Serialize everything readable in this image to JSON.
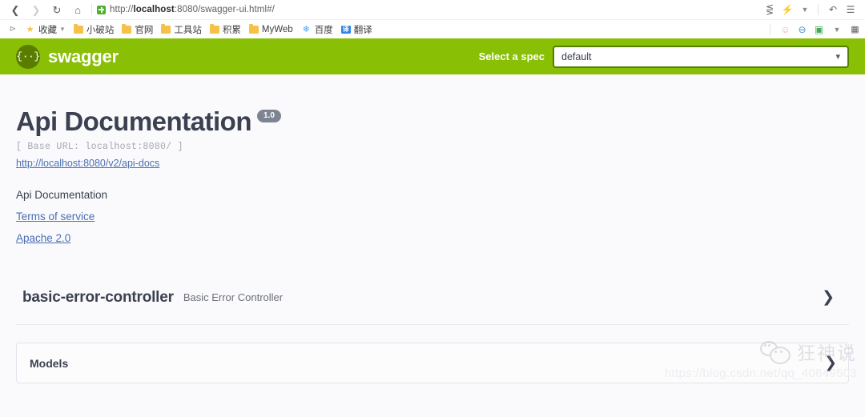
{
  "browser": {
    "nav": {
      "back_icon": "chevron-left-icon",
      "forward_icon": "chevron-right-icon",
      "reload_icon": "reload-icon",
      "home_icon": "home-icon"
    },
    "url": {
      "security_icon": "shield-secure-icon",
      "scheme": "http://",
      "host": "localhost",
      "path": ":8080/swagger-ui.html#/",
      "full": "http://localhost:8080/swagger-ui.html#/"
    },
    "toolbar_right": [
      {
        "name": "share-icon",
        "glyph": "≪"
      },
      {
        "name": "lightning-icon",
        "glyph": "⚡"
      },
      {
        "name": "chevron-down-icon",
        "glyph": "⌵"
      },
      {
        "name": "undo-icon",
        "glyph": "↶"
      },
      {
        "name": "menu-icon",
        "glyph": "☰"
      }
    ],
    "bookmarks": {
      "expand_icon": "bookmarks-expand-icon",
      "items": [
        {
          "label": "收藏",
          "icon": "star-folder-icon",
          "has_caret": true
        },
        {
          "label": "小破站",
          "icon": "folder-icon",
          "has_caret": false
        },
        {
          "label": "官网",
          "icon": "folder-icon",
          "has_caret": false
        },
        {
          "label": "工具站",
          "icon": "folder-icon",
          "has_caret": false
        },
        {
          "label": "积累",
          "icon": "folder-icon",
          "has_caret": false
        },
        {
          "label": "MyWeb",
          "icon": "folder-icon",
          "has_caret": false
        },
        {
          "label": "百度",
          "icon": "baidu-icon",
          "has_caret": false
        },
        {
          "label": "翻译",
          "icon": "translate-icon",
          "has_caret": false
        }
      ],
      "extensions": [
        {
          "name": "cat-extension-icon",
          "glyph": "◑",
          "color": "#f4a7b9"
        },
        {
          "name": "adblock-extension-icon",
          "glyph": "⊖",
          "color": "#4e8ed6"
        },
        {
          "name": "translate-extension-icon",
          "glyph": "⬚",
          "color": "#3faa57"
        },
        {
          "name": "grid-menu-icon",
          "glyph": "∷",
          "color": "#5a5a5a"
        }
      ]
    }
  },
  "swagger": {
    "logo_glyph": "{··}",
    "logo_text": "swagger",
    "spec_label": "Select a spec",
    "spec_value": "default",
    "spec_chevron_icon": "chevron-down-icon",
    "brand_color": "#89bf04"
  },
  "info": {
    "title": "Api Documentation",
    "version": "1.0",
    "base_url": "[ Base URL: localhost:8080/ ]",
    "docs_link": "http://localhost:8080/v2/api-docs",
    "description": "Api Documentation",
    "terms_link": "Terms of service",
    "license_link": "Apache 2.0"
  },
  "tags": [
    {
      "name": "basic-error-controller",
      "description": "Basic Error Controller",
      "chevron_icon": "chevron-right-icon",
      "expanded": false
    }
  ],
  "models": {
    "title": "Models",
    "chevron_icon": "chevron-right-icon",
    "expanded": false
  },
  "watermark": {
    "brand": "狂神说",
    "url": "https://blog.csdn.net/qq_40649503"
  }
}
